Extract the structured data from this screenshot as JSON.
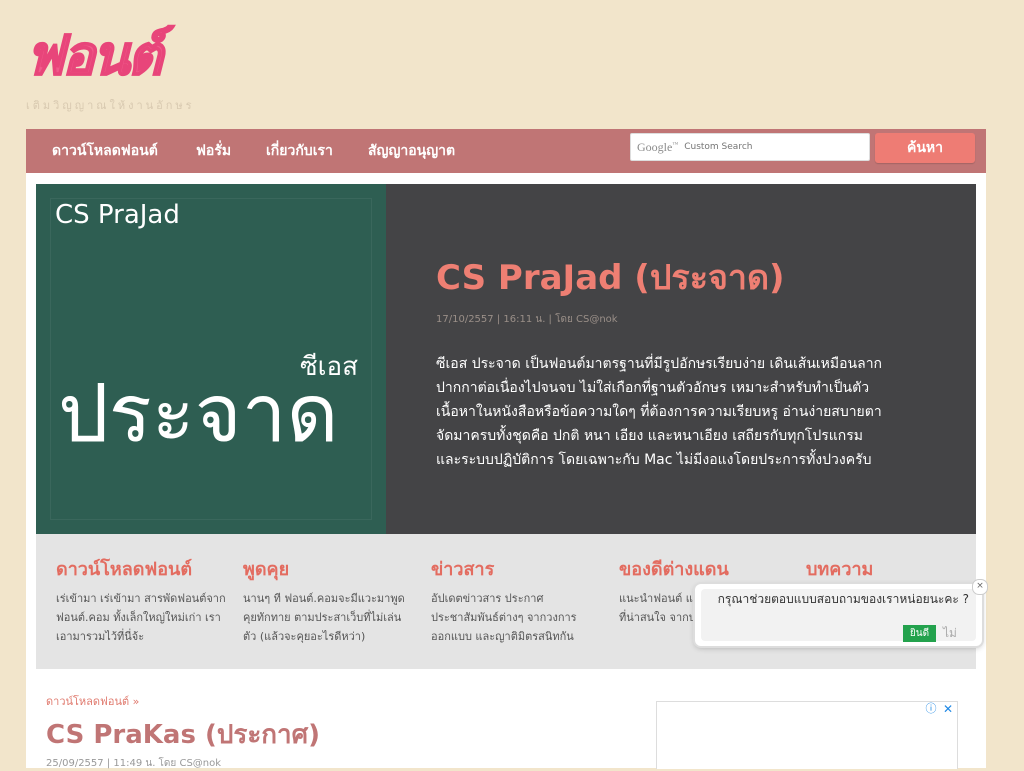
{
  "logo": {
    "text": "ฟอนต์",
    "tagline": "เติมวิญญาณให้งานอักษร"
  },
  "nav": {
    "items": [
      {
        "label": "ดาวน์โหลดฟอนต์"
      },
      {
        "label": "ฟอรั่ม"
      },
      {
        "label": "เกี่ยวกับเรา"
      },
      {
        "label": "สัญญาอนุญาต"
      }
    ],
    "search": {
      "brand": "Google",
      "placeholder": "Custom Search",
      "button": "ค้นหา"
    }
  },
  "hero": {
    "art": {
      "name": "CS PraJad",
      "small": "ซีเอส",
      "big": "ประจาด"
    },
    "title": "CS PraJad (ประจาด)",
    "meta": "17/10/2557 | 16:11 น. | โดย CS@nok",
    "description": "ซีเอส ประจาด เป็นฟอนต์มาตรฐานที่มีรูปอักษรเรียบง่าย เดินเส้นเหมือนลากปากกาต่อเนื่องไปจนจบ ไม่ใส่เกือกที่ฐานตัวอักษร เหมาะสำหรับทำเป็นตัวเนื้อหาในหนังสือหรือข้อความใดๆ ที่ต้องการความเรียบหรู อ่านง่ายสบายตา จัดมาครบทั้งชุดคือ ปกติ หนา เอียง และหนาเอียง เสถียรกับทุกโปรแกรมและระบบปฏิบัติการ โดยเฉพาะกับ Mac ไม่มีงอแงโดยประการทั้งปวงครับ"
  },
  "features": [
    {
      "title": "ดาวน์โหลดฟอนต์",
      "text": "เร่เข้ามา เร่เข้ามา สารพัดฟอนต์จากฟอนต์.คอม ทั้งเล็กใหญ่ใหม่เก่า เราเอามารวมไว้ที่นี่จ้ะ"
    },
    {
      "title": "พูดคุย",
      "text": "นานๆ ที ฟอนต์.คอมจะมีแวะมาพูดคุยทักทาย ตามประสาเว็บที่ไม่เล่นตัว (แล้วจะคุยอะไรดีหว่า)"
    },
    {
      "title": "ข่าวสาร",
      "text": "อัปเดตข่าวสาร ประกาศประชาสัมพันธ์ต่างๆ จากวงการออกแบบ และญาติมิตรสนิทกัน"
    },
    {
      "title": "ของดีต่างแดน",
      "text": "แนะนำฟอนต์ และงานออกแบบดีๆ ที่น่าสนใจ จากบล็อก"
    },
    {
      "title": "บทความ",
      "text": ""
    }
  ],
  "post": {
    "breadcrumb": "ดาวน์โหลดฟอนต์ »",
    "title": "CS PraKas (ประกาศ)",
    "meta": "25/09/2557 | 11:49 น. โดย CS@nok"
  },
  "ad": {
    "info_icon": "info-icon",
    "close_icon": "close-icon"
  },
  "survey": {
    "text": "กรุณาช่วยตอบแบบสอบถามของเราหน่อยนะคะ ?",
    "yes": "ยินดี",
    "no": "ไม่",
    "close": "×"
  },
  "colors": {
    "background": "#f2e5cb",
    "nav": "#c07575",
    "accent": "#ee7f73",
    "hero_dark": "#444446",
    "hero_art": "#2e5e52",
    "logo_pink": "#f05a8a"
  }
}
